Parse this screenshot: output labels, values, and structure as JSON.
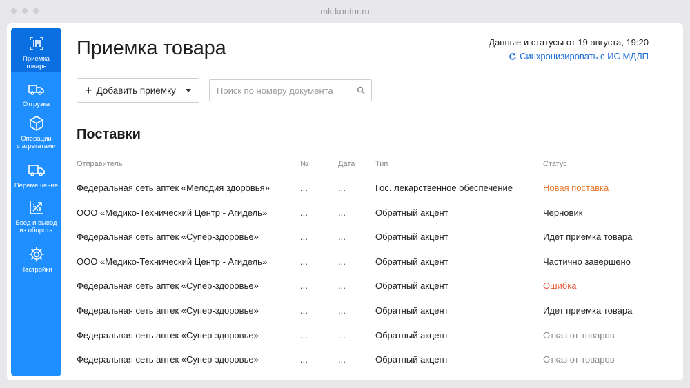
{
  "browser": {
    "url": "mk.kontur.ru"
  },
  "sidebar": {
    "items": [
      {
        "label": "Приемка\nтовара",
        "icon": "barcode-scan-icon",
        "active": true
      },
      {
        "label": "Отгрузка",
        "icon": "truck-icon",
        "active": false
      },
      {
        "label": "Операции\nс агрегатами",
        "icon": "box-icon",
        "active": false
      },
      {
        "label": "Перемещение",
        "icon": "delivery-truck-icon",
        "active": false
      },
      {
        "label": "Ввод и вывод\nиз оборота",
        "icon": "circulation-icon",
        "active": false
      },
      {
        "label": "Настройки",
        "icon": "gear-icon",
        "active": false
      }
    ]
  },
  "header": {
    "title": "Приемка товара",
    "status": "Данные и статусы от 19 августа, 19:20",
    "sync_label": "Синхронизировать с ИС МДЛП"
  },
  "toolbar": {
    "add_label": "Добавить приемку",
    "search_placeholder": "Поиск по номеру документа"
  },
  "section": {
    "title": "Поставки"
  },
  "table": {
    "columns": [
      "Отправитель",
      "№",
      "Дата",
      "Тип",
      "Статус"
    ],
    "rows": [
      {
        "sender": "Федеральная сеть аптек «Мелодия здоровья»",
        "number": "...",
        "date": "...",
        "type": "Гос. лекарственное обеспечение",
        "status": "Новая поставка",
        "status_color": "#e8782c"
      },
      {
        "sender": "ООО «Медико-Технический Центр - Агидель»",
        "number": "...",
        "date": "...",
        "type": "Обратный акцент",
        "status": "Черновик",
        "status_color": "#222222"
      },
      {
        "sender": "Федеральная сеть аптек «Супер-здоровье»",
        "number": "...",
        "date": "...",
        "type": "Обратный акцент",
        "status": "Идет приемка товара",
        "status_color": "#222222"
      },
      {
        "sender": "ООО «Медико-Технический Центр - Агидель»",
        "number": "...",
        "date": "...",
        "type": "Обратный акцент",
        "status": "Частично завершено",
        "status_color": "#222222"
      },
      {
        "sender": "Федеральная сеть аптек «Супер-здоровье»",
        "number": "...",
        "date": "...",
        "type": "Обратный акцент",
        "status": "Ошибка",
        "status_color": "#e85b3c"
      },
      {
        "sender": "Федеральная сеть аптек «Супер-здоровье»",
        "number": "...",
        "date": "...",
        "type": "Обратный акцент",
        "status": "Идет приемка товара",
        "status_color": "#222222"
      },
      {
        "sender": "Федеральная сеть аптек «Супер-здоровье»",
        "number": "...",
        "date": "...",
        "type": "Обратный акцент",
        "status": "Отказ от товаров",
        "status_color": "#8c8c8c"
      },
      {
        "sender": "Федеральная сеть аптек «Супер-здоровье»",
        "number": "...",
        "date": "...",
        "type": "Обратный акцент",
        "status": "Отказ от товаров",
        "status_color": "#8c8c8c"
      }
    ]
  },
  "colors": {
    "accent": "#1f8fff",
    "accent_active": "#0a6fe0",
    "link": "#1f6fd6"
  }
}
